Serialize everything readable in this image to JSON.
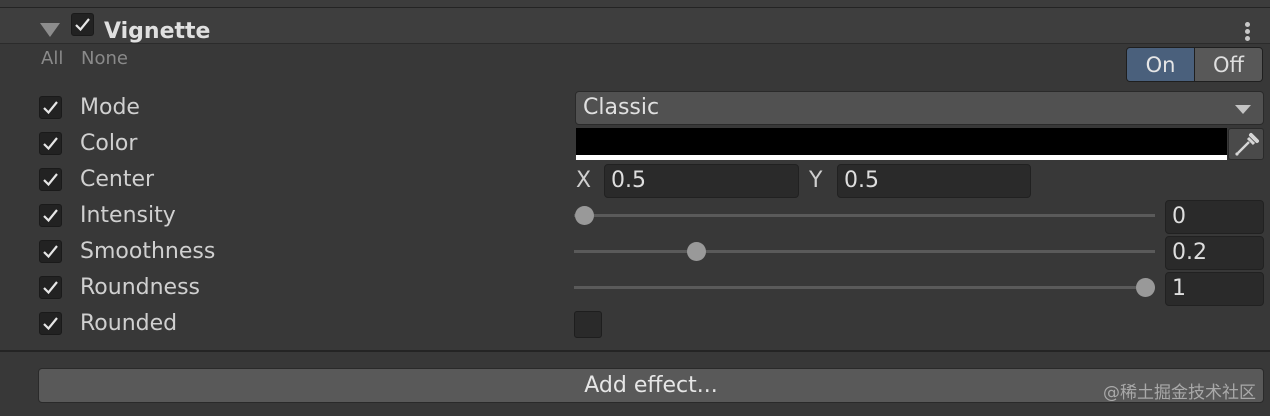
{
  "header": {
    "title": "Vignette",
    "enabled": true
  },
  "override_links": {
    "all": "All",
    "none": "None"
  },
  "toggle": {
    "on": "On",
    "off": "Off",
    "active": "On"
  },
  "properties": {
    "mode": {
      "label": "Mode",
      "value": "Classic"
    },
    "color": {
      "label": "Color",
      "value": "#000000"
    },
    "center": {
      "label": "Center",
      "x_label": "X",
      "x": "0.5",
      "y_label": "Y",
      "y": "0.5"
    },
    "intensity": {
      "label": "Intensity",
      "value": "0",
      "level": 0
    },
    "smoothness": {
      "label": "Smoothness",
      "value": "0.2",
      "level": 0.2
    },
    "roundness": {
      "label": "Roundness",
      "value": "1",
      "level": 1
    },
    "rounded": {
      "label": "Rounded",
      "checked": false
    }
  },
  "footer": {
    "add_effect": "Add effect..."
  },
  "watermark": "@稀土掘金技术社区",
  "colors": {
    "accent": "#4a607c",
    "panel": "#383838",
    "field": "#2a2a2a"
  },
  "icons": [
    "foldout-arrow-icon",
    "checkmark-icon",
    "kebab-menu-icon",
    "dropdown-caret-icon",
    "eyedropper-icon"
  ]
}
